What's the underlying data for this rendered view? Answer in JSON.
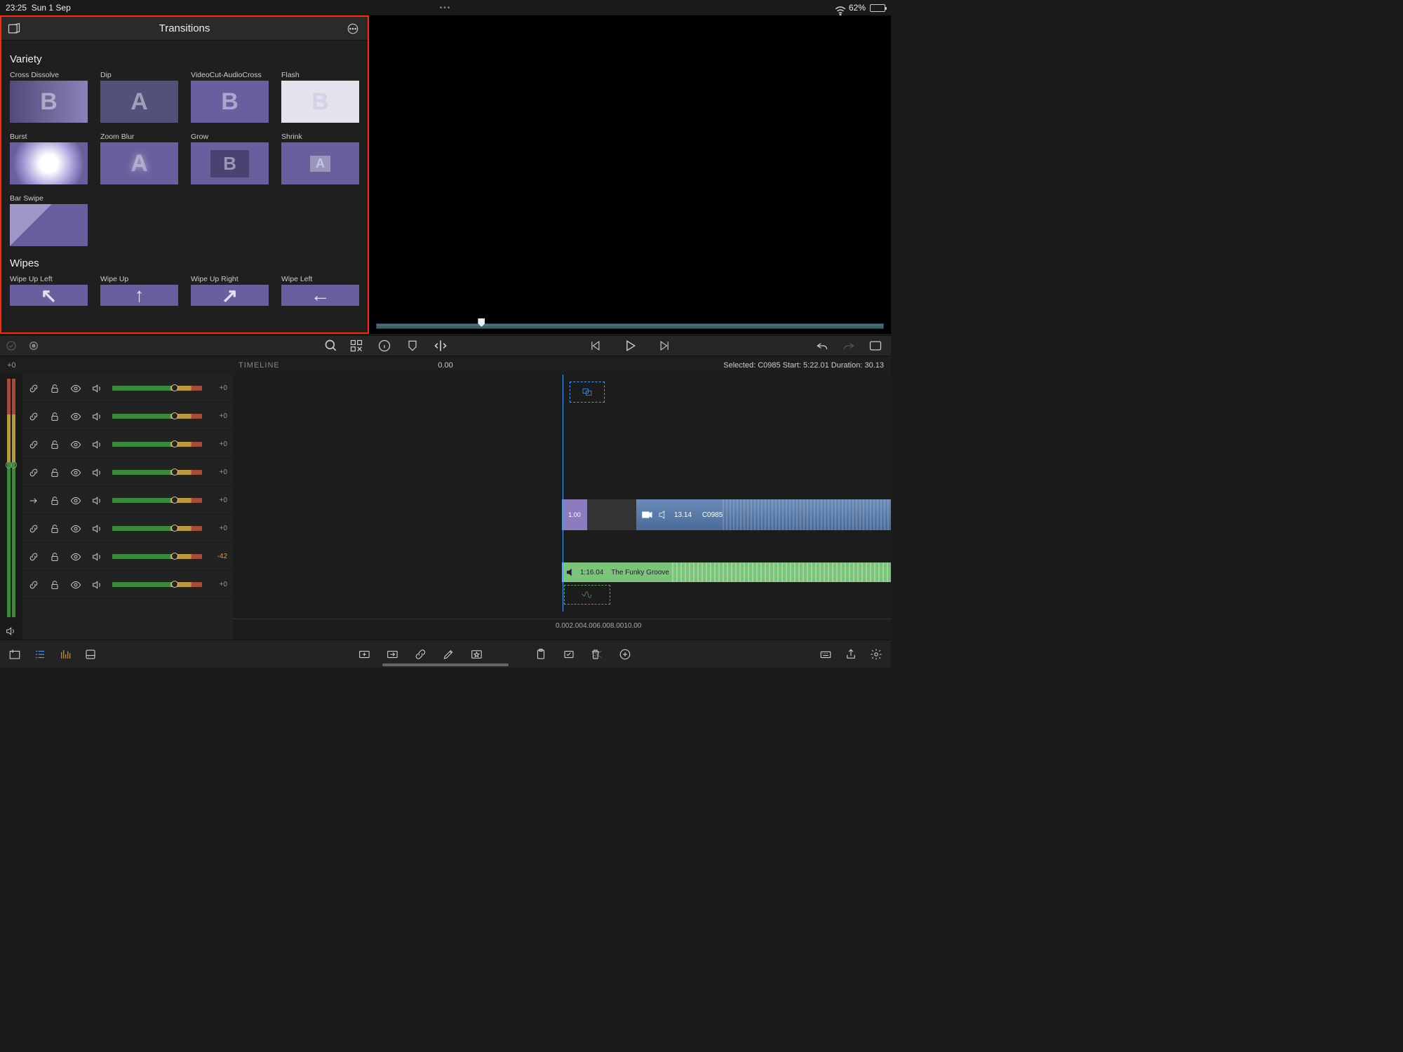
{
  "status": {
    "time": "23:25",
    "date": "Sun 1 Sep",
    "battery": "62%"
  },
  "panel": {
    "title": "Transitions",
    "sections": [
      {
        "name": "Variety",
        "items": [
          {
            "label": "Cross Dissolve",
            "glyph": "B",
            "style": "dissolve"
          },
          {
            "label": "Dip",
            "glyph": "A",
            "style": "dip"
          },
          {
            "label": "VideoCut-AudioCross",
            "glyph": "B",
            "style": ""
          },
          {
            "label": "Flash",
            "glyph": "B",
            "style": "flash"
          },
          {
            "label": "Burst",
            "glyph": "",
            "style": "burst"
          },
          {
            "label": "Zoom Blur",
            "glyph": "A",
            "style": "blur"
          },
          {
            "label": "Grow",
            "glyph": "B",
            "style": "grow"
          },
          {
            "label": "Shrink",
            "glyph": "A",
            "style": "shrink"
          },
          {
            "label": "Bar Swipe",
            "glyph": "",
            "style": "barswipe"
          }
        ]
      },
      {
        "name": "Wipes",
        "items": [
          {
            "label": "Wipe Up Left",
            "arrow": "↖"
          },
          {
            "label": "Wipe Up",
            "arrow": "↑"
          },
          {
            "label": "Wipe Up Right",
            "arrow": "↗"
          },
          {
            "label": "Wipe Left",
            "arrow": "←"
          }
        ]
      }
    ]
  },
  "timeline": {
    "label": "TIMELINE",
    "offset": "+0",
    "position": "0.00",
    "selection": "Selected: C0985 Start: 5:22.01 Duration: 30.13",
    "tracks": [
      {
        "type": "link",
        "db": "+0"
      },
      {
        "type": "link",
        "db": "+0"
      },
      {
        "type": "link",
        "db": "+0"
      },
      {
        "type": "link",
        "db": "+0"
      },
      {
        "type": "arrow",
        "db": "+0"
      },
      {
        "type": "link",
        "db": "+0"
      },
      {
        "type": "link",
        "db": "-42",
        "neg": true
      },
      {
        "type": "link",
        "db": "+0"
      }
    ],
    "clip_video": {
      "handle": "1.00",
      "time": "13.14",
      "name": "C0985"
    },
    "clip_audio": {
      "time": "1:16.04",
      "name": "The Funky Groove"
    },
    "ruler": [
      "0.00",
      "2.00",
      "4.00",
      "6.00",
      "8.00",
      "10.00"
    ]
  }
}
